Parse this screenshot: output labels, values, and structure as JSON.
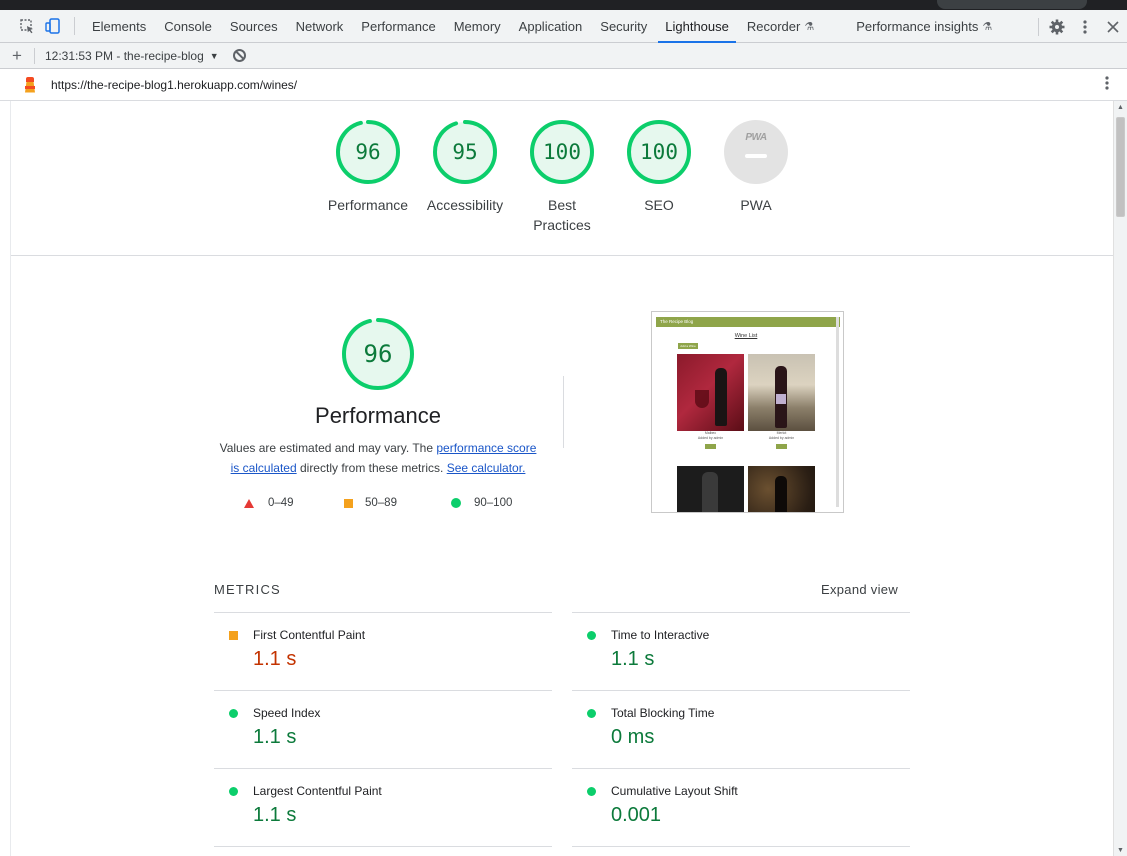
{
  "devtools": {
    "tabs": [
      {
        "label": "Elements"
      },
      {
        "label": "Console"
      },
      {
        "label": "Sources"
      },
      {
        "label": "Network"
      },
      {
        "label": "Performance"
      },
      {
        "label": "Memory"
      },
      {
        "label": "Application"
      },
      {
        "label": "Security"
      },
      {
        "label": "Lighthouse",
        "active": true
      },
      {
        "label": "Recorder",
        "experimental": true
      },
      {
        "label": "Performance insights",
        "experimental": true
      }
    ],
    "icons": [
      "inspect-icon",
      "device-toolbar-icon",
      "settings-icon",
      "kebab-menu-icon",
      "close-icon"
    ]
  },
  "report_toolbar": {
    "add_icon": "plus-icon",
    "report_selector": "12:31:53 PM - the-recipe-blog",
    "clear_icon": "block-icon"
  },
  "url_bar": {
    "url": "https://the-recipe-blog1.herokuapp.com/wines/"
  },
  "summary_gauges": [
    {
      "score": "96",
      "label": "Performance",
      "fraction": 0.96
    },
    {
      "score": "95",
      "label": "Accessibility",
      "fraction": 0.95
    },
    {
      "score": "100",
      "label": "Best Practices",
      "label_line1": "Best",
      "label_line2": "Practices",
      "fraction": 1.0
    },
    {
      "score": "100",
      "label": "SEO",
      "fraction": 1.0
    },
    {
      "score": "",
      "label": "PWA",
      "badge_text": "PWA"
    }
  ],
  "performance": {
    "score": "96",
    "fraction": 0.96,
    "title": "Performance",
    "desc_prefix": "Values are estimated and may vary. The ",
    "link1": "performance score is calculated",
    "desc_middle": " directly from these metrics. ",
    "link2": "See calculator.",
    "legend": [
      {
        "shape": "triangle",
        "range": "0–49",
        "color": "#e53935"
      },
      {
        "shape": "square",
        "range": "50–89",
        "color": "#f4a11d"
      },
      {
        "shape": "circle",
        "range": "90–100",
        "color": "#0cce6b"
      }
    ]
  },
  "screenshot": {
    "site_name": "The Recipe Blog",
    "heading": "Wine List",
    "add_button": "Add a Wine",
    "cards": [
      {
        "caption": "Malbec",
        "sub": "Added by admin"
      },
      {
        "caption": "Merlot",
        "sub": "Added by admin"
      },
      {
        "caption": "",
        "sub": ""
      },
      {
        "caption": "",
        "sub": ""
      }
    ]
  },
  "metrics": {
    "header": "METRICS",
    "expand_label": "Expand view",
    "items": [
      {
        "name": "First Contentful Paint",
        "value": "1.1 s",
        "rating": "average"
      },
      {
        "name": "Time to Interactive",
        "value": "1.1 s",
        "rating": "good"
      },
      {
        "name": "Speed Index",
        "value": "1.1 s",
        "rating": "good"
      },
      {
        "name": "Total Blocking Time",
        "value": "0 ms",
        "rating": "good"
      },
      {
        "name": "Largest Contentful Paint",
        "value": "1.1 s",
        "rating": "good"
      },
      {
        "name": "Cumulative Layout Shift",
        "value": "0.001",
        "rating": "good"
      }
    ]
  },
  "colors": {
    "pass": "#0cce6b",
    "pass_text": "#0c7a3b",
    "average": "#f4a11d",
    "average_text": "#c33300",
    "fail": "#e53935",
    "link": "#1a56c8",
    "active_tab": "#1a73e8"
  }
}
